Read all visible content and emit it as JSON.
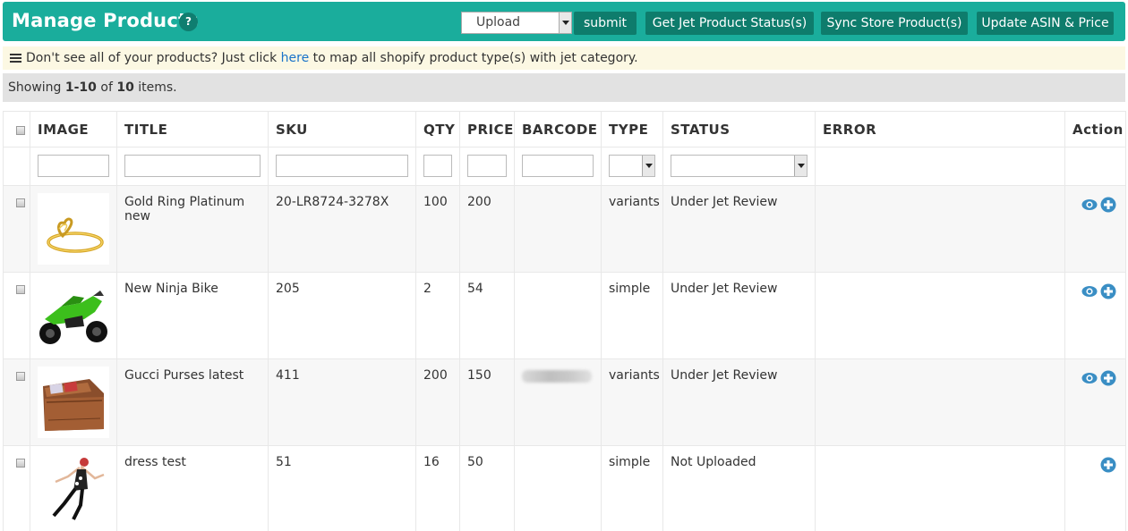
{
  "header": {
    "title": "Manage Products",
    "help": "?",
    "upload_select": "Upload",
    "submit": "submit",
    "btn_status": "Get Jet Product Status(s)",
    "btn_sync": "Sync Store Product(s)",
    "btn_asin": "Update ASIN & Price"
  },
  "notice": {
    "text_before": "Don't see all of your products? Just click ",
    "link": "here",
    "text_after": " to map all shopify product type(s) with jet category."
  },
  "summary": {
    "prefix": "Showing ",
    "range": "1-10",
    "of": " of ",
    "total": "10",
    "suffix": " items."
  },
  "columns": [
    "IMAGE",
    "TITLE",
    "SKU",
    "QTY",
    "PRICE",
    "BARCODE",
    "TYPE",
    "STATUS",
    "ERROR",
    "Action"
  ],
  "rows": [
    {
      "image": "ring-image",
      "title": "Gold Ring Platinum new",
      "sku": "20-LR8724-3278X",
      "qty": "100",
      "price": "200",
      "barcode": "",
      "type": "variants",
      "status": "Under Jet Review",
      "error": "",
      "actions": [
        "view-icon",
        "add-icon"
      ]
    },
    {
      "image": "motorbike-image",
      "title": "New Ninja Bike",
      "sku": "205",
      "qty": "2",
      "price": "54",
      "barcode": "",
      "type": "simple",
      "status": "Under Jet Review",
      "error": "",
      "actions": [
        "view-icon",
        "add-icon"
      ]
    },
    {
      "image": "wallet-image",
      "title": "Gucci Purses latest",
      "sku": "411",
      "qty": "200",
      "price": "150",
      "barcode": "454550",
      "type": "variants",
      "status": "Under Jet Review",
      "error": "",
      "actions": [
        "view-icon",
        "add-icon"
      ]
    },
    {
      "image": "dancer-image",
      "title": "dress test",
      "sku": "51",
      "qty": "16",
      "price": "50",
      "barcode": "",
      "type": "simple",
      "status": "Not Uploaded",
      "error": "",
      "actions": [
        "add-icon"
      ]
    }
  ],
  "colors": {
    "header": "#1aad9c",
    "button": "#0e7c6c",
    "notice_bg": "#fcf8e3",
    "link": "#1a73c9",
    "action_icon": "#3a8ec4"
  }
}
